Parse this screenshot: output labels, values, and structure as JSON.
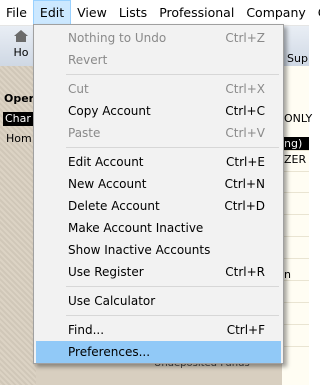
{
  "menubar": [
    "File",
    "Edit",
    "View",
    "Lists",
    "Professional",
    "Company",
    "Cu"
  ],
  "toolbar": {
    "home_label": "Ho",
    "sup_label": "Sup"
  },
  "side": {
    "open_label": "Oper",
    "selected_label": "Char",
    "home_label": "Hom"
  },
  "right_panel": {
    "row1": "ONLY",
    "row2": "ng)",
    "row3": "ZER",
    "row4": "n"
  },
  "bottom_text": "Undeposited Funds",
  "edit_menu": {
    "items": [
      {
        "label": "Nothing to Undo",
        "shortcut": "Ctrl+Z",
        "disabled": true
      },
      {
        "label": "Revert",
        "shortcut": "",
        "disabled": true
      },
      {
        "label": "Cut",
        "shortcut": "Ctrl+X",
        "disabled": true
      },
      {
        "label": "Copy Account",
        "shortcut": "Ctrl+C",
        "disabled": false
      },
      {
        "label": "Paste",
        "shortcut": "Ctrl+V",
        "disabled": true
      },
      {
        "label": "Edit Account",
        "shortcut": "Ctrl+E",
        "disabled": false
      },
      {
        "label": "New Account",
        "shortcut": "Ctrl+N",
        "disabled": false
      },
      {
        "label": "Delete Account",
        "shortcut": "Ctrl+D",
        "disabled": false
      },
      {
        "label": "Make Account Inactive",
        "shortcut": "",
        "disabled": false
      },
      {
        "label": "Show Inactive Accounts",
        "shortcut": "",
        "disabled": false
      },
      {
        "label": "Use Register",
        "shortcut": "Ctrl+R",
        "disabled": false
      },
      {
        "label": "Use Calculator",
        "shortcut": "",
        "disabled": false
      },
      {
        "label": "Find...",
        "shortcut": "Ctrl+F",
        "disabled": false
      },
      {
        "label": "Preferences...",
        "shortcut": "",
        "disabled": false,
        "highlighted": true
      }
    ]
  }
}
